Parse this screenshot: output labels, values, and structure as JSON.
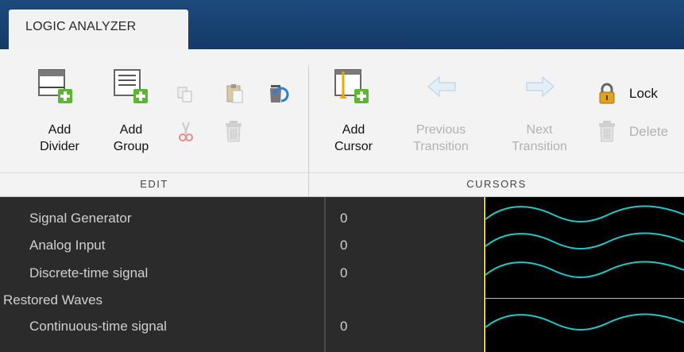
{
  "app": {
    "tab_title": "LOGIC ANALYZER"
  },
  "colors": {
    "title_bar": "#1c4a7c",
    "ribbon": "#f3f3f3",
    "signal_panel": "#2b2b2b",
    "waveform": "#1fc7c7",
    "cursor": "#e8d400"
  },
  "ribbon": {
    "edit": {
      "section_label": "EDIT",
      "add_divider": {
        "line1": "Add",
        "line2": "Divider",
        "icon": "add-divider-icon"
      },
      "add_group": {
        "line1": "Add",
        "line2": "Group",
        "icon": "add-group-icon"
      },
      "copy_icon": "copy-icon",
      "paste_icon": "paste-icon",
      "cut_icon": "cut-icon",
      "delete_icon": "trash-icon",
      "undo_icon": "undo-trash-icon"
    },
    "cursors": {
      "section_label": "CURSORS",
      "add_cursor": {
        "line1": "Add",
        "line2": "Cursor",
        "icon": "add-cursor-icon"
      },
      "previous_transition": {
        "line1": "Previous",
        "line2": "Transition",
        "icon": "arrow-left-icon"
      },
      "next_transition": {
        "line1": "Next",
        "line2": "Transition",
        "icon": "arrow-right-icon"
      },
      "lock": {
        "label": "Lock",
        "icon": "lock-icon"
      },
      "delete": {
        "label": "Delete",
        "icon": "trash-icon"
      }
    }
  },
  "signals": [
    {
      "name": "Signal Generator",
      "value": "0"
    },
    {
      "name": "Analog Input",
      "value": "0"
    },
    {
      "name": "Discrete-time signal",
      "value": "0"
    },
    {
      "name": "Restored Waves",
      "value": ""
    },
    {
      "name": "Continuous-time signal",
      "value": "0"
    }
  ]
}
